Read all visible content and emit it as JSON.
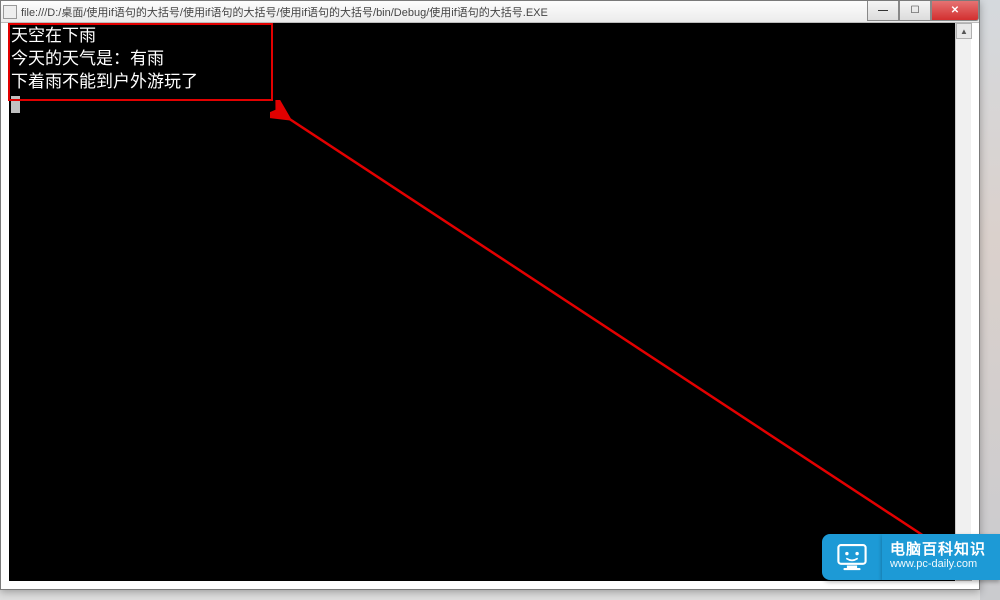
{
  "window": {
    "title": "file:///D:/桌面/使用if语句的大括号/使用if语句的大括号/使用if语句的大括号/bin/Debug/使用if语句的大括号.EXE"
  },
  "console": {
    "lines": [
      "天空在下雨",
      "今天的天气是：有雨",
      "下着雨不能到户外游玩了"
    ]
  },
  "annotation": {
    "highlight_box": "output-highlight",
    "arrow": "pointer-arrow"
  },
  "watermark": {
    "title": "电脑百科知识",
    "url": "www.pc-daily.com"
  },
  "colors": {
    "highlight": "#e20000",
    "badge": "#1d9ad6",
    "console_bg": "#000000",
    "console_fg": "#ffffff"
  }
}
